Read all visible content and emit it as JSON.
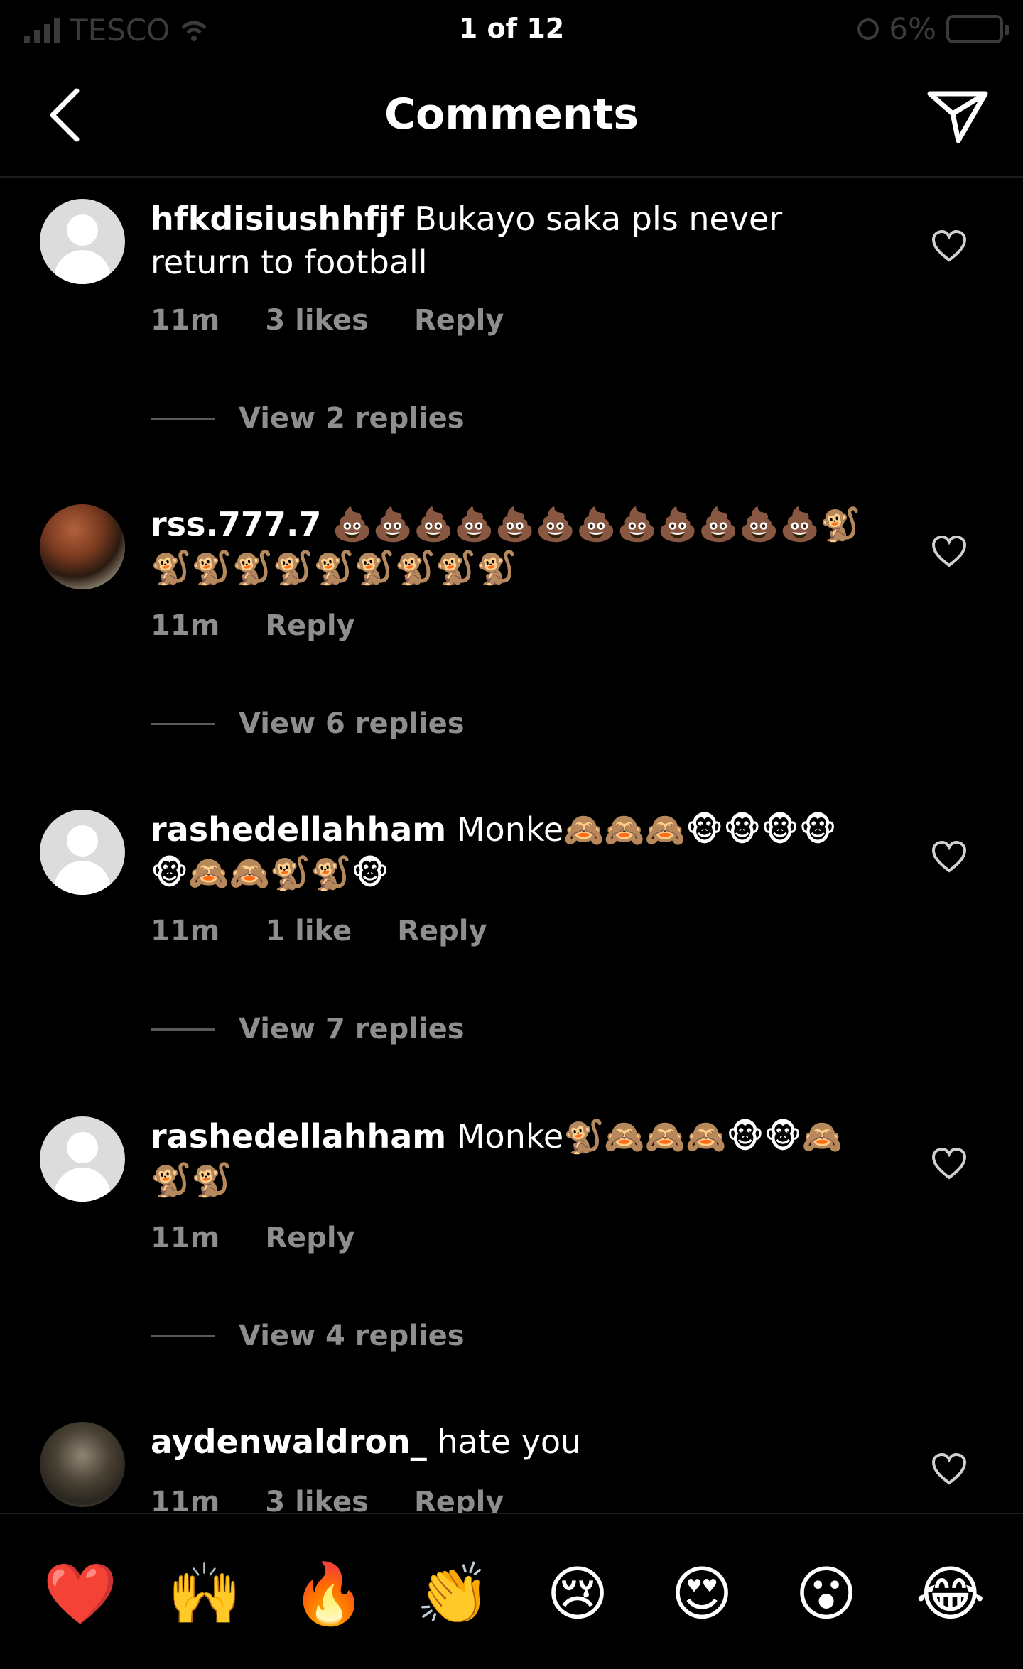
{
  "status_bar": {
    "carrier": "TESCO",
    "page_indicator": "1 of 12",
    "battery": "6%"
  },
  "nav": {
    "title": "Comments",
    "back_icon": "chevron-left-icon",
    "share_icon": "paper-plane-icon"
  },
  "comments": [
    {
      "username": "hfkdisiushhfjf",
      "text": "Bukayo saka pls never return to football",
      "time": "11m",
      "likes": "3 likes",
      "reply": "Reply",
      "view_replies": "View 2 replies",
      "avatar": "default"
    },
    {
      "username": "rss.777.7",
      "text": "💩💩💩💩💩💩💩💩💩💩💩💩🐒🐒🐒🐒🐒🐒🐒🐒🐒🐒",
      "time": "11m",
      "likes": "",
      "reply": "Reply",
      "view_replies": "View 6 replies",
      "avatar": "photo"
    },
    {
      "username": "rashedellahham",
      "text": "Monke🙈🙈🙈🐵🐵🐵🐵🐵🙈🙈🐒🐒🐵",
      "time": "11m",
      "likes": "1 like",
      "reply": "Reply",
      "view_replies": "View 7 replies",
      "avatar": "default"
    },
    {
      "username": "rashedellahham",
      "text": "Monke🐒🙈🙈🙈🐵🐵🙈🐒🐒",
      "time": "11m",
      "likes": "",
      "reply": "Reply",
      "view_replies": "View 4 replies",
      "avatar": "default"
    },
    {
      "username": "aydenwaldron_",
      "text": "hate you",
      "time": "11m",
      "likes": "3 likes",
      "reply": "Reply",
      "avatar": "photo"
    }
  ],
  "reactions": [
    "❤️",
    "🙌",
    "🔥",
    "👏",
    "😢",
    "😍",
    "😮",
    "😂"
  ]
}
